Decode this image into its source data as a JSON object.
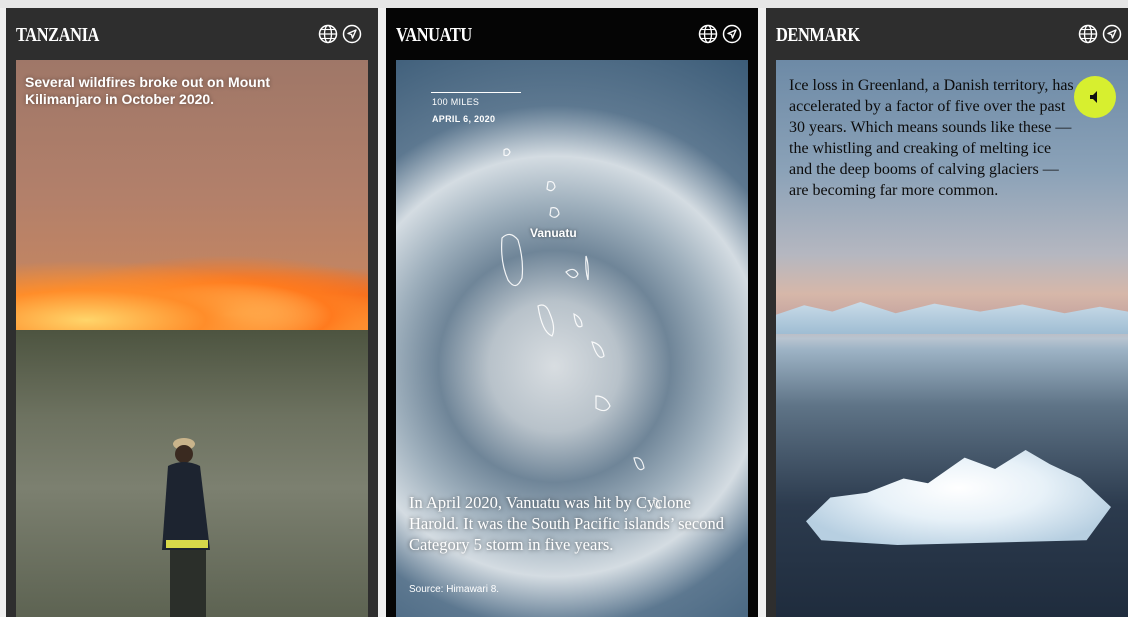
{
  "panels": [
    {
      "country": "TANZANIA",
      "caption": "Several wildfires broke out on Mount Kilimanjaro in October 2020.",
      "icons": [
        "globe-icon",
        "location-arrow-icon"
      ]
    },
    {
      "country": "VANUATU",
      "scale_label": "100 MILES",
      "date_label": "APRIL 6, 2020",
      "place_label": "Vanuatu",
      "caption": "In April 2020, Vanuatu was hit by Cyclone Harold. It was the South Pacific islands’ second Category 5 storm in five years.",
      "source": "Source: Himawari 8.",
      "icons": [
        "globe-icon",
        "location-arrow-icon"
      ]
    },
    {
      "country": "DENMARK",
      "caption": "Ice loss in Greenland, a Danish territory, has accelerated by a factor of five over the past 30 years. Which means sounds like these — the whistling and creaking of melting ice and the deep booms of calving glaciers — are becoming far more common.",
      "icons": [
        "globe-icon",
        "location-arrow-icon",
        "speaker-icon"
      ],
      "audio_button_color": "#d7ef2f"
    }
  ]
}
